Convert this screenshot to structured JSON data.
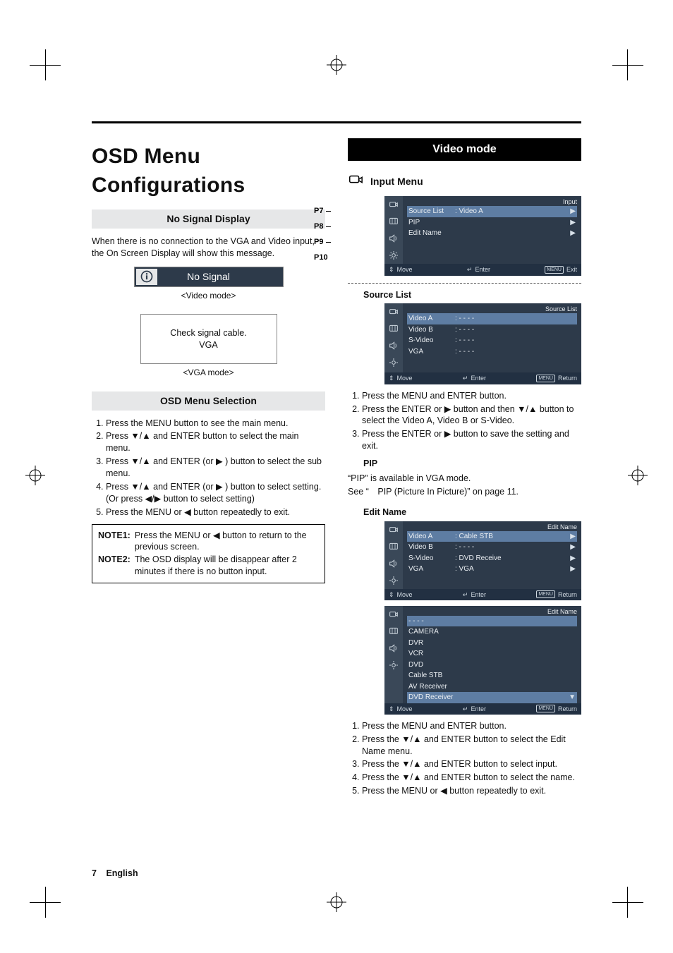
{
  "page": {
    "title": "OSD Menu Configurations",
    "number": "7",
    "lang": "English"
  },
  "left": {
    "section_no_signal": "No Signal Display",
    "no_signal_intro": "When there is no connection to the VGA and Video input, the On Screen Display will show this message.",
    "no_signal_label": "No Signal",
    "video_mode_caption": "<Video mode>",
    "vga_box_line1": "Check signal cable.",
    "vga_box_line2": "VGA",
    "vga_mode_caption": "<VGA mode>",
    "section_osd_sel": "OSD Menu Selection",
    "osd_steps": [
      "Press the MENU button to see the main menu.",
      "Press ▼/▲ and ENTER button to select the main menu.",
      "Press ▼/▲ and ENTER (or ▶ ) button to select the sub menu.",
      "Press ▼/▲ and ENTER (or ▶ ) button to select setting. (Or press ◀/▶ button to select setting)",
      "Press the MENU or ◀ button repeatedly to exit."
    ],
    "notes": [
      {
        "label": "NOTE1:",
        "text": "Press the MENU or ◀ button to return to the previous screen."
      },
      {
        "label": "NOTE2:",
        "text": "The OSD display will be disappear after 2 minutes if there is no button input."
      }
    ]
  },
  "right": {
    "video_mode": "Video mode",
    "input_menu": "Input Menu",
    "p_labels": [
      "P7",
      "P8",
      "P9",
      "P10"
    ],
    "input_osd": {
      "title": "Input",
      "rows": [
        {
          "k": "Source List",
          "v": ": Video A",
          "arr": "▶",
          "sel": true
        },
        {
          "k": "PIP",
          "v": "",
          "arr": "▶",
          "sel": false
        },
        {
          "k": "Edit Name",
          "v": "",
          "arr": "▶",
          "sel": false
        }
      ],
      "footer": {
        "move": "Move",
        "enter": "Enter",
        "exit": "Exit"
      }
    },
    "source_list": {
      "heading": "Source List",
      "title": "Source List",
      "rows": [
        {
          "k": "Video A",
          "v": ": - - - -",
          "sel": true
        },
        {
          "k": "Video B",
          "v": ": - - - -",
          "sel": false
        },
        {
          "k": "S-Video",
          "v": ": - - - -",
          "sel": false
        },
        {
          "k": "VGA",
          "v": ": - - - -",
          "sel": false
        }
      ],
      "footer": {
        "move": "Move",
        "enter": "Enter",
        "ret": "Return"
      },
      "steps": [
        "Press the MENU and ENTER button.",
        "Press the ENTER or ▶ button and then ▼/▲ button to select the Video A, Video B or S-Video.",
        "Press the ENTER or ▶ button to save the setting and exit."
      ]
    },
    "pip": {
      "heading": "PIP",
      "line1": "“PIP” is available in VGA mode.",
      "line2": "See “ PIP (Picture In Picture)” on page 11."
    },
    "edit_name": {
      "heading": "Edit Name",
      "panel1": {
        "title": "Edit Name",
        "rows": [
          {
            "k": "Video A",
            "v": ": Cable STB",
            "arr": "▶",
            "sel": true
          },
          {
            "k": "Video B",
            "v": ": - - - -",
            "arr": "▶",
            "sel": false
          },
          {
            "k": "S-Video",
            "v": ": DVD Receive",
            "arr": "▶",
            "sel": false
          },
          {
            "k": "VGA",
            "v": ": VGA",
            "arr": "▶",
            "sel": false
          }
        ],
        "footer": {
          "move": "Move",
          "enter": "Enter",
          "ret": "Return"
        }
      },
      "panel2": {
        "title": "Edit Name",
        "rows": [
          {
            "k": "- - - -",
            "sel": true
          },
          {
            "k": "CAMERA",
            "sel": false
          },
          {
            "k": "DVR",
            "sel": false
          },
          {
            "k": "VCR",
            "sel": false
          },
          {
            "k": "DVD",
            "sel": false
          },
          {
            "k": "Cable STB",
            "sel": false
          },
          {
            "k": "AV Receiver",
            "sel": false
          },
          {
            "k": "DVD Receiver",
            "sel": false,
            "scroll": true
          }
        ],
        "footer": {
          "move": "Move",
          "enter": "Enter",
          "ret": "Return"
        }
      },
      "steps": [
        "Press the MENU and ENTER button.",
        "Press the ▼/▲ and ENTER button to select the Edit Name menu.",
        "Press the ▼/▲ and ENTER button to select input.",
        "Press the ▼/▲ and ENTER button to select the name.",
        "Press the MENU or ◀ button repeatedly to exit."
      ]
    }
  }
}
